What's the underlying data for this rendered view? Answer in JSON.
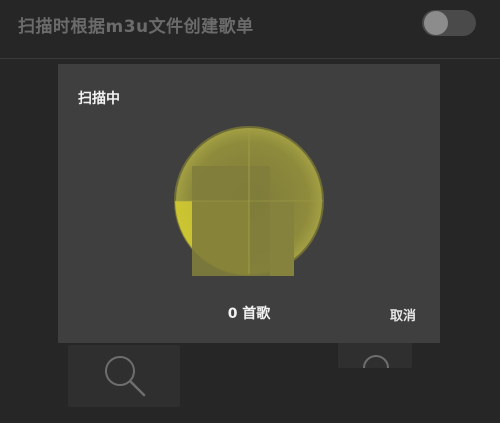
{
  "setting": {
    "label": "扫描时根据m3u文件创建歌单",
    "toggle_on": false
  },
  "dialog": {
    "title": "扫描中",
    "song_count": "0 首歌",
    "cancel_label": "取消"
  },
  "colors": {
    "background": "#262626",
    "dialog_bg": "#3f3f3f",
    "radar_fill": "#8a8a3a",
    "radar_sweep": "#d6cf2c",
    "text_primary": "#f2f2f2",
    "text_dim": "#6b6b6b"
  },
  "icons": {
    "background_search": "search-icon"
  }
}
